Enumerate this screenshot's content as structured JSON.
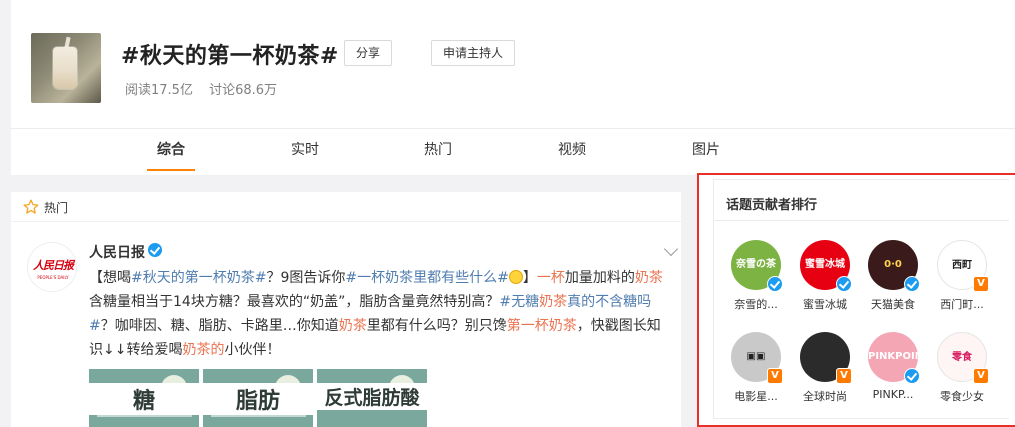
{
  "topic": {
    "title": "#秋天的第一杯奶茶#",
    "share_label": "分享",
    "host_label": "申请主持人",
    "reads": "阅读17.5亿",
    "discussions": "讨论68.6万"
  },
  "tabs": [
    {
      "label": "综合",
      "active": true
    },
    {
      "label": "实时",
      "active": false
    },
    {
      "label": "热门",
      "active": false
    },
    {
      "label": "视频",
      "active": false
    },
    {
      "label": "图片",
      "active": false
    }
  ],
  "feed": {
    "section_label": "热门",
    "author": "人民日报",
    "avatar_text": "人民日报",
    "avatar_subtext": "PEOPLE'S DAILY",
    "post": {
      "p1": "【想喝",
      "tag1": "#秋天的第一杯奶茶#",
      "p2": "？9图告诉你",
      "tag2a": "#一杯奶茶",
      "tag2b": "里都有些什么#",
      "p3": "】",
      "hl1": "一杯",
      "p4": "加量加料的",
      "hl2": "奶茶",
      "p5": "含糖量相当于14块方糖？最喜欢的",
      "p6": "“奶盖”，脂肪含量竟然特别高？",
      "tag3a": "#无糖",
      "tag3b": "奶茶",
      "tag3c": "真的不含糖吗#",
      "p7": "？咖啡因、糖、脂肪、卡路里…你知道",
      "hl3": "奶茶",
      "p8": "里都有什么吗？别只馋",
      "hl4": "第一杯奶茶",
      "p9": "，快戳图长知识↓↓转给爱喝",
      "hl5": "奶茶的",
      "p10": "小伙伴！"
    },
    "thumbnails": [
      "糖",
      "脂肪",
      "反式脂肪酸"
    ]
  },
  "contributors": {
    "title": "话题贡献者排行",
    "items": [
      {
        "name": "奈雪的...",
        "avatar_text": "奈雪の茶",
        "bg": "#7cb342",
        "fg": "#ffffff",
        "badge": "blue"
      },
      {
        "name": "蜜雪冰城",
        "avatar_text": "蜜雪冰城",
        "bg": "#e60012",
        "fg": "#ffffff",
        "badge": "blue"
      },
      {
        "name": "天猫美食",
        "avatar_text": "0·0",
        "bg": "#3a1a1a",
        "fg": "#ffd54f",
        "badge": "blue"
      },
      {
        "name": "西门町...",
        "avatar_text": "西町",
        "bg": "#ffffff",
        "fg": "#222222",
        "badge": "orange"
      },
      {
        "name": "电影星...",
        "avatar_text": "▣▣",
        "bg": "#c9c9c9",
        "fg": "#222222",
        "badge": "orange"
      },
      {
        "name": "全球时尚",
        "avatar_text": "",
        "bg": "#2b2b2b",
        "fg": "#ffffff",
        "badge": "orange"
      },
      {
        "name": "PINKP...",
        "avatar_text": "PINKPOINT",
        "bg": "#f4a6b5",
        "fg": "#ffffff",
        "badge": "blue"
      },
      {
        "name": "零食少女",
        "avatar_text": "零食",
        "bg": "#fff5f5",
        "fg": "#d81b60",
        "badge": "orange"
      }
    ]
  }
}
